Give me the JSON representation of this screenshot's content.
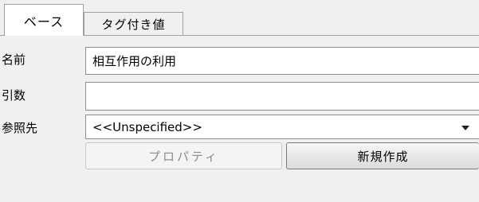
{
  "tabs": {
    "base": "ベース",
    "tagged_values": "タグ付き値"
  },
  "form": {
    "name_label": "名前",
    "name_value": "相互作用の利用",
    "args_label": "引数",
    "args_value": "",
    "ref_label": "参照先",
    "ref_value": "<<Unspecified>>"
  },
  "buttons": {
    "properties": "プロパティ",
    "new": "新規作成"
  }
}
